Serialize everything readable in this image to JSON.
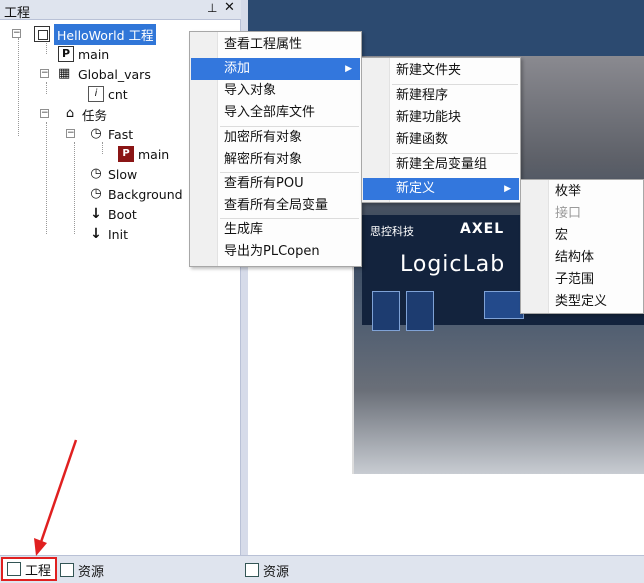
{
  "panel": {
    "title": "工程",
    "pin_icon": "pin-icon",
    "close_icon": "close-icon"
  },
  "tree": {
    "project": "HelloWorld 工程",
    "main": "main",
    "global_vars": "Global_vars",
    "cnt": "cnt",
    "tasks": "任务",
    "fast": "Fast",
    "fast_main": "main",
    "slow": "Slow",
    "background": "Background",
    "boot": "Boot",
    "init": "Init"
  },
  "bottom_left_tabs": [
    "工程",
    "资源"
  ],
  "bottom_right_tabs": [
    "资源"
  ],
  "menu1": [
    "查看工程属性",
    "添加",
    "导入对象",
    "导入全部库文件",
    "加密所有对象",
    "解密所有对象",
    "查看所有POU",
    "查看所有全局变量",
    "生成库",
    "导出为PLCopen"
  ],
  "menu2": [
    "新建文件夹",
    "新建程序",
    "新建功能块",
    "新建函数",
    "新建全局变量组",
    "新定义"
  ],
  "menu3": [
    "枚举",
    "接口",
    "宏",
    "结构体",
    "子范围",
    "类型定义"
  ],
  "image": {
    "brand_small": "思控科技",
    "brand_axel": "AXEL",
    "brand_main": "LogicLab"
  },
  "colors": {
    "selection": "#3076d8",
    "menu_highlight": "#3377dd",
    "annotation_red": "#e02020"
  }
}
